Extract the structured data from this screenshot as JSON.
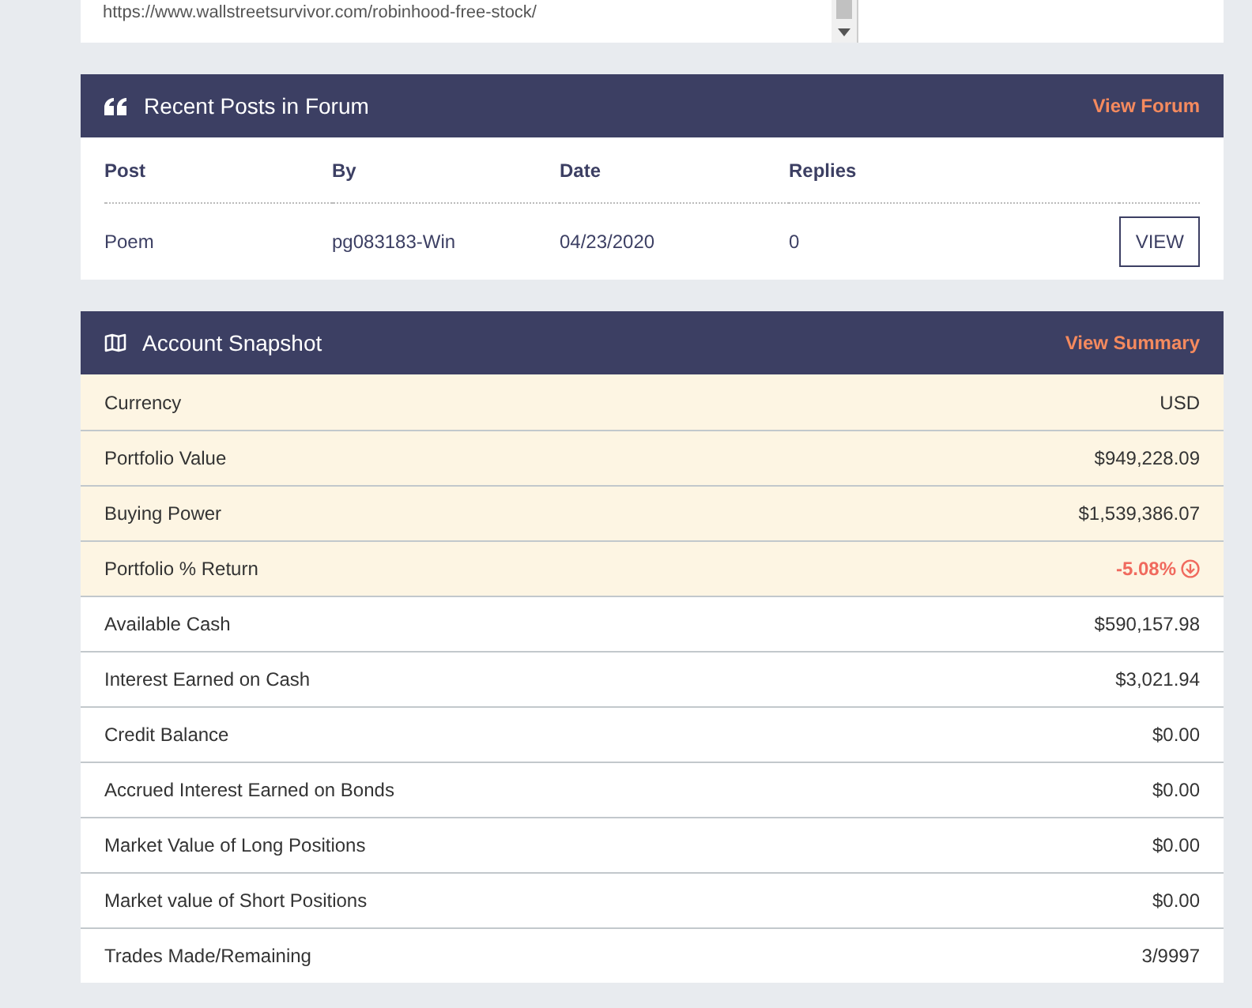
{
  "link_box": {
    "value": "https://www.wallstreetsurvivor.com/robinhood-free-stock/"
  },
  "forum": {
    "title": "Recent Posts in Forum",
    "action": "View Forum",
    "columns": [
      "Post",
      "By",
      "Date",
      "Replies"
    ],
    "rows": [
      {
        "cells": [
          "Poem",
          "pg083183-Win",
          "04/23/2020",
          "0"
        ],
        "button": "VIEW"
      }
    ]
  },
  "snapshot": {
    "title": "Account Snapshot",
    "action": "View Summary",
    "rows": [
      {
        "label": "Currency",
        "value": "USD",
        "highlighted": true,
        "negative": false
      },
      {
        "label": "Portfolio Value",
        "value": "$949,228.09",
        "highlighted": true,
        "negative": false
      },
      {
        "label": "Buying Power",
        "value": "$1,539,386.07",
        "highlighted": true,
        "negative": false
      },
      {
        "label": "Portfolio % Return",
        "value": "-5.08%",
        "highlighted": true,
        "negative": true
      },
      {
        "label": "Available Cash",
        "value": "$590,157.98",
        "highlighted": false,
        "negative": false
      },
      {
        "label": "Interest Earned on Cash",
        "value": "$3,021.94",
        "highlighted": false,
        "negative": false
      },
      {
        "label": "Credit Balance",
        "value": "$0.00",
        "highlighted": false,
        "negative": false
      },
      {
        "label": "Accrued Interest Earned on Bonds",
        "value": "$0.00",
        "highlighted": false,
        "negative": false
      },
      {
        "label": "Market Value of Long Positions",
        "value": "$0.00",
        "highlighted": false,
        "negative": false
      },
      {
        "label": "Market value of Short Positions",
        "value": "$0.00",
        "highlighted": false,
        "negative": false
      },
      {
        "label": "Trades Made/Remaining",
        "value": "3/9997",
        "highlighted": false,
        "negative": false
      }
    ]
  }
}
